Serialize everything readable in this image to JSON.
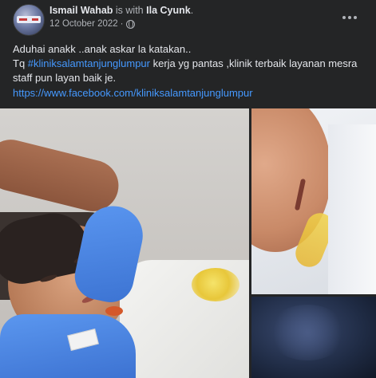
{
  "post": {
    "author": "Ismail Wahab",
    "with_text": "is with",
    "tagged": "Ila Cyunk",
    "tagged_suffix": ".",
    "date": "12 October 2022",
    "date_separator": "·",
    "privacy_icon": "globe-icon",
    "more_icon": "more-options-icon",
    "text": {
      "line1": "Aduhai anakk ..anak askar la katakan..",
      "line2_prefix": "Tq ",
      "hashtag": "#kliniksalamtanjunglumpur",
      "line2_suffix": " kerja yg pantas ,klinik terbaik layanan mesra staff pun layan baik je."
    },
    "link": "https://www.facebook.com/kliniksalamtanjunglumpur"
  },
  "colors": {
    "background": "#242526",
    "text_primary": "#e4e6eb",
    "text_secondary": "#b0b3b8",
    "link": "#4599ff",
    "glove": "#4b88e8"
  }
}
